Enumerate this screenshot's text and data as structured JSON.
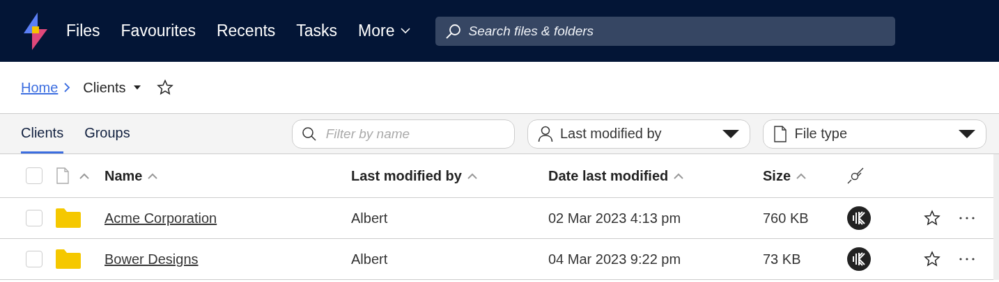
{
  "nav": {
    "items": [
      {
        "label": "Files",
        "kind": "link"
      },
      {
        "label": "Favourites",
        "kind": "link"
      },
      {
        "label": "Recents",
        "kind": "link"
      },
      {
        "label": "Tasks",
        "kind": "link"
      },
      {
        "label": "More",
        "kind": "menu"
      }
    ],
    "search": {
      "placeholder": "Search files & folders"
    }
  },
  "breadcrumb": {
    "items": [
      {
        "label": "Home",
        "kind": "link"
      },
      {
        "label": "Clients",
        "kind": "current"
      }
    ],
    "favourite": false
  },
  "tabs": [
    {
      "label": "Clients",
      "selected": true
    },
    {
      "label": "Groups",
      "selected": false
    }
  ],
  "filters": {
    "name": {
      "placeholder": "Filter by name"
    },
    "dropdowns": [
      {
        "label": "Last modified by",
        "kind": "person"
      },
      {
        "label": "File type",
        "kind": "file"
      }
    ]
  },
  "table": {
    "select_all_checked": false,
    "columns": [
      "Name",
      "Last modified by",
      "Date last modified",
      "Size"
    ],
    "rows": [
      {
        "name": "Acme Corporation",
        "modified_by": "Albert",
        "date": "02 Mar 2023 4:13 pm",
        "size": "760 KB",
        "checked": false,
        "favourite": false
      },
      {
        "name": "Bower Designs",
        "modified_by": "Albert",
        "date": "04 Mar 2023 9:22 pm",
        "size": "73 KB",
        "checked": false,
        "favourite": false
      }
    ]
  }
}
